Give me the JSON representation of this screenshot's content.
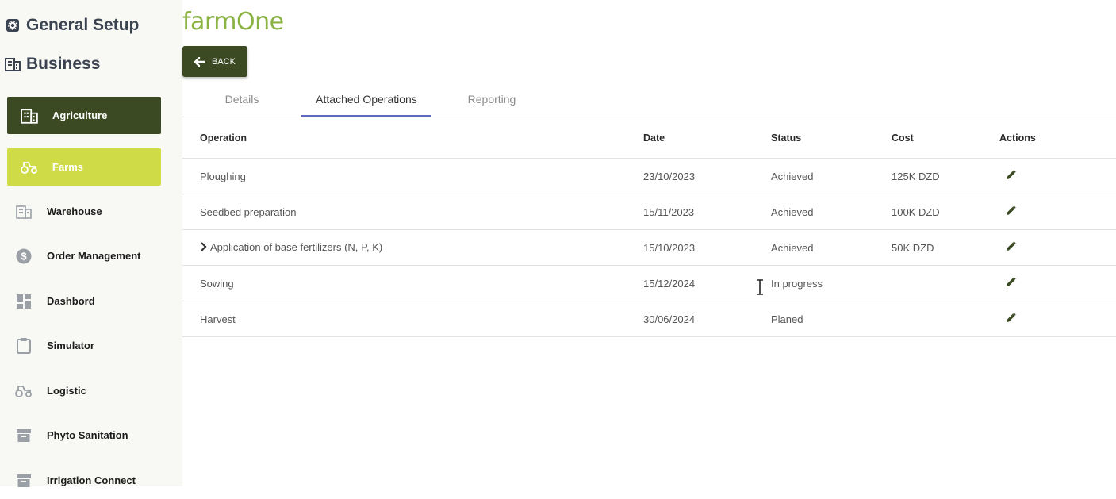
{
  "sidebar": {
    "general_setup": "General Setup",
    "business": "Business",
    "items": [
      {
        "label": "Agriculture",
        "icon": "building-icon",
        "state": "active-parent"
      },
      {
        "label": "Farms",
        "icon": "tractor-icon",
        "state": "active"
      },
      {
        "label": "Warehouse",
        "icon": "warehouse-icon"
      },
      {
        "label": "Order Management",
        "icon": "dollar-icon"
      },
      {
        "label": "Dashbord",
        "icon": "dashboard-icon"
      },
      {
        "label": "Simulator",
        "icon": "clipboard-icon"
      },
      {
        "label": "Logistic",
        "icon": "tractor-icon"
      },
      {
        "label": "Phyto Sanitation",
        "icon": "archive-icon"
      },
      {
        "label": "Irrigation Connect",
        "icon": "archive-icon"
      }
    ]
  },
  "header": {
    "title": "farmOne",
    "back_label": "BACK"
  },
  "tabs": [
    {
      "label": "Details"
    },
    {
      "label": "Attached Operations",
      "active": true
    },
    {
      "label": "Reporting"
    }
  ],
  "table": {
    "columns": [
      "Operation",
      "Date",
      "Status",
      "Cost",
      "Actions"
    ],
    "rows": [
      {
        "operation": "Ploughing",
        "date": "23/10/2023",
        "status": "Achieved",
        "cost": "125K DZD"
      },
      {
        "operation": "Seedbed preparation",
        "date": "15/11/2023",
        "status": "Achieved",
        "cost": "100K DZD"
      },
      {
        "operation": "Application of base fertilizers (N, P, K)",
        "date": "15/10/2023",
        "status": "Achieved",
        "cost": "50K DZD",
        "expandable": true
      },
      {
        "operation": "Sowing",
        "date": "15/12/2024",
        "status": "In progress",
        "cost": ""
      },
      {
        "operation": "Harvest",
        "date": "30/06/2024",
        "status": "Planed",
        "cost": ""
      }
    ]
  },
  "colors": {
    "primary_dark": "#3b4a23",
    "accent_lime": "#cfdc48",
    "title_green": "#8bb343",
    "tab_indicator": "#5c6bc0"
  }
}
